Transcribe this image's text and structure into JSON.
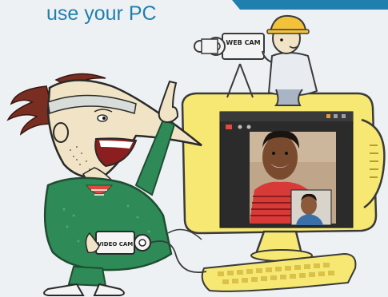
{
  "headline": {
    "top_cropped_text": "",
    "subtitle": "use your PC"
  },
  "illustration": {
    "camera_label_top": "WEB CAM",
    "camera_label_bottom": "VIDEO CAM",
    "skin_color": "#f1e4c6",
    "monitor_color": "#f6e873",
    "sweater_color": "#2e8b57",
    "screen_bg": "#2b2b2b",
    "accent_red": "#e04a3c"
  },
  "video_call": {
    "window_title": "",
    "remote_person": "smiling man in red striped shirt",
    "self_view": "small inset of second person"
  }
}
